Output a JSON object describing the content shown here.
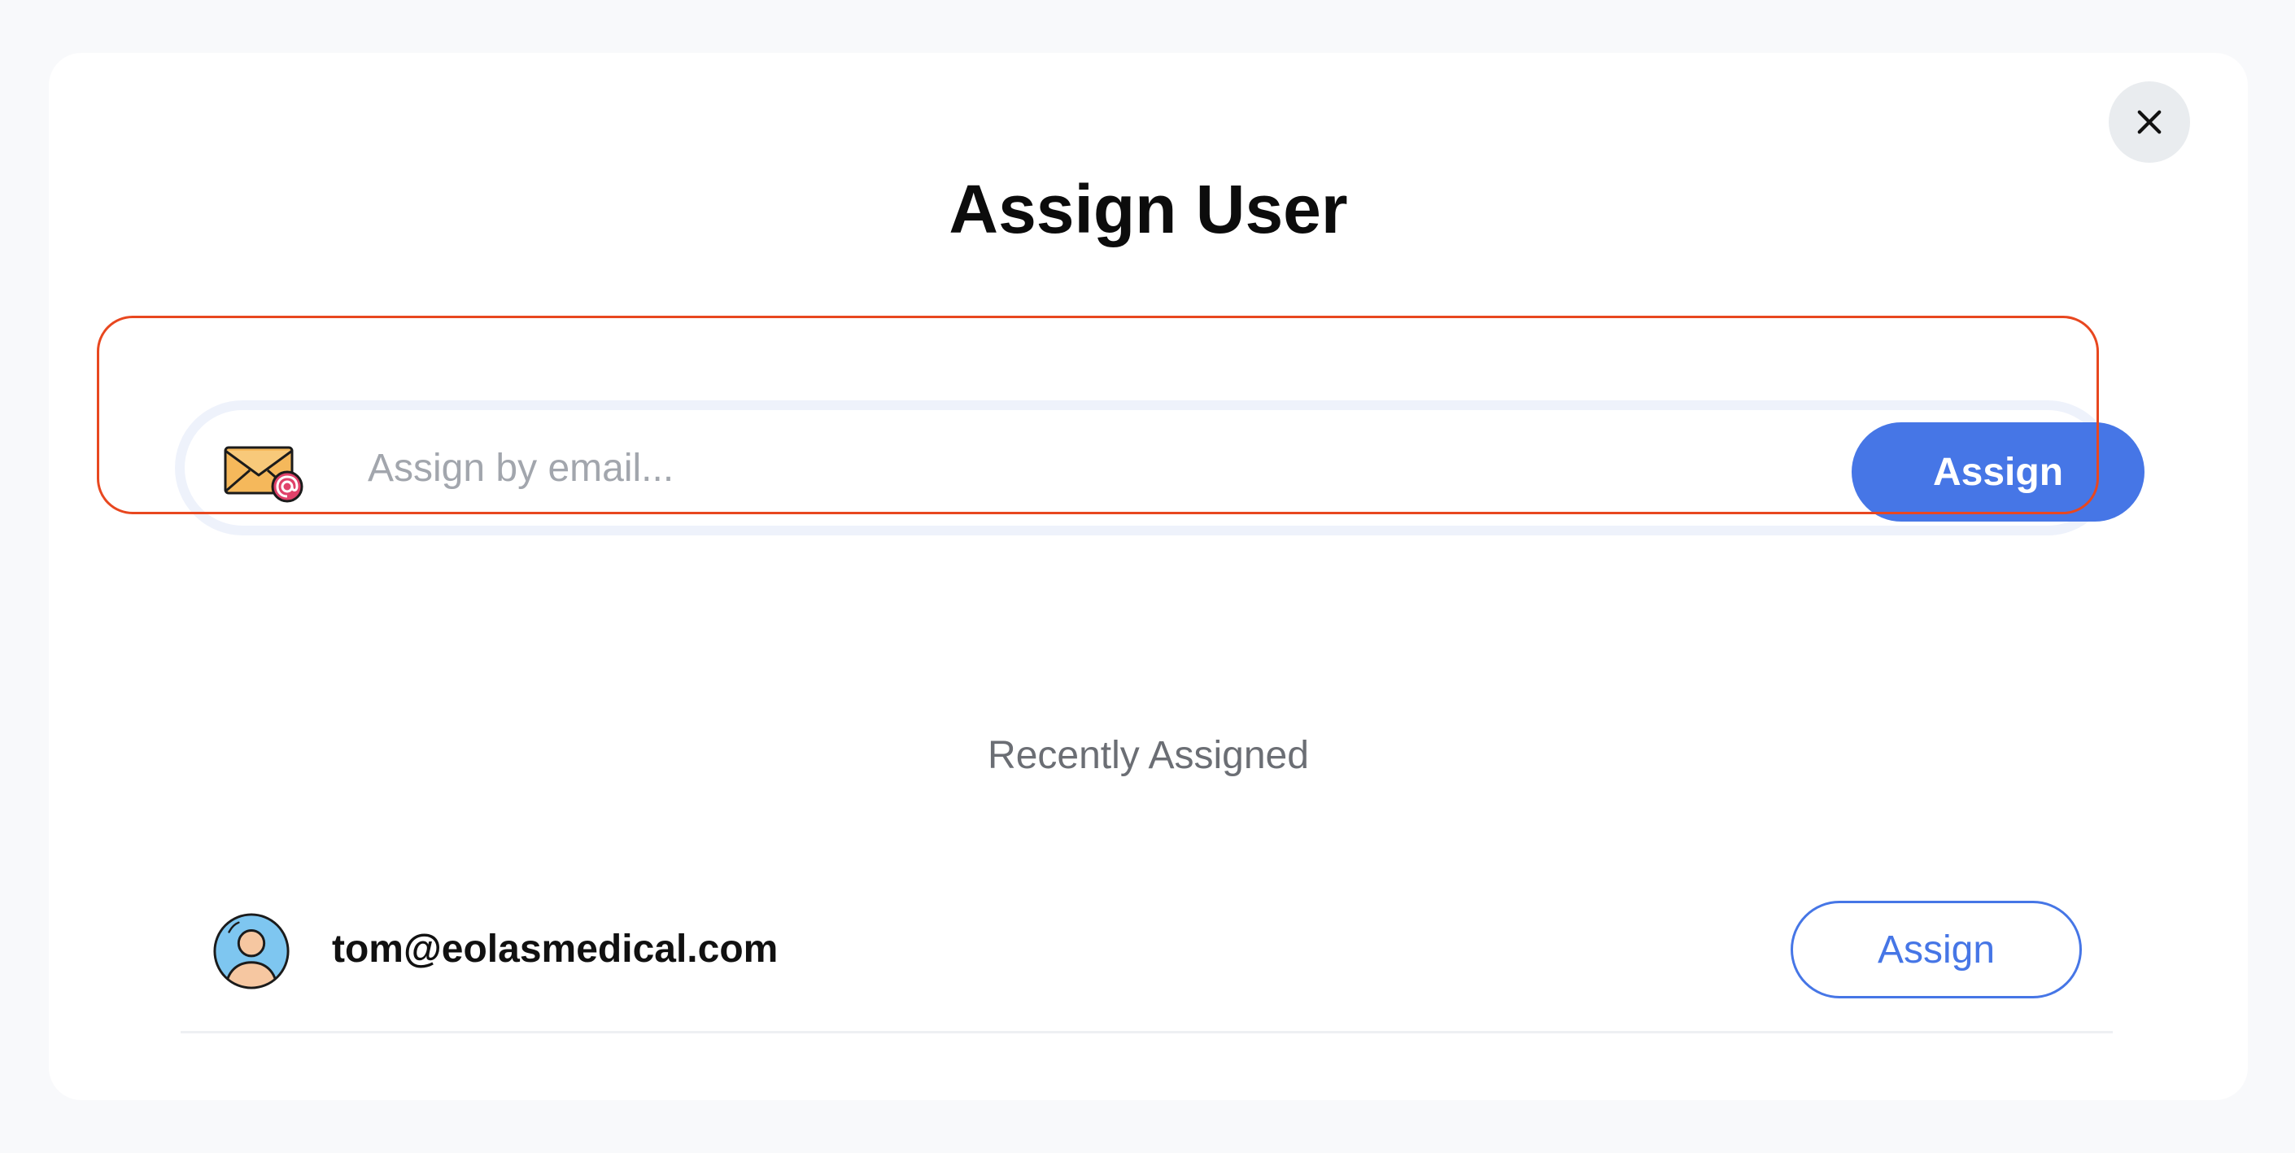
{
  "modal": {
    "title": "Assign User",
    "close_icon": "close-icon"
  },
  "search": {
    "icon": "email-icon",
    "placeholder": "Assign by email...",
    "value": "",
    "button_label": "Assign"
  },
  "recent": {
    "heading": "Recently Assigned",
    "users": [
      {
        "avatar_icon": "user-avatar-icon",
        "email": "tom@eolasmedical.com",
        "button_label": "Assign"
      }
    ]
  },
  "colors": {
    "accent": "#4676e6",
    "highlight_border": "#e8471f",
    "close_bg": "#e9ecef"
  }
}
